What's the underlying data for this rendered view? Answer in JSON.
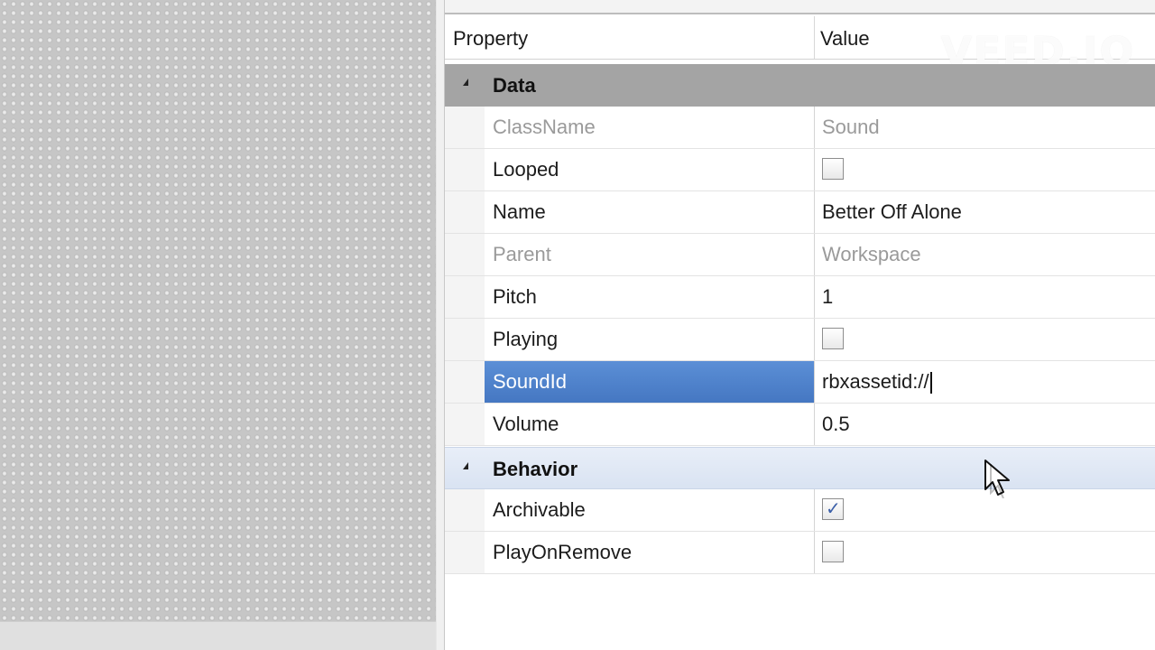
{
  "header": {
    "property_label": "Property",
    "value_label": "Value"
  },
  "watermark": "VEED.IO",
  "categories": {
    "data": {
      "label": "Data",
      "rows": [
        {
          "name": "ClassName",
          "value": "Sound",
          "readonly": true
        },
        {
          "name": "Looped",
          "type": "checkbox",
          "checked": false
        },
        {
          "name": "Name",
          "value": "Better Off Alone"
        },
        {
          "name": "Parent",
          "value": "Workspace",
          "readonly": true
        },
        {
          "name": "Pitch",
          "value": "1"
        },
        {
          "name": "Playing",
          "type": "checkbox",
          "checked": false
        },
        {
          "name": "SoundId",
          "value": "rbxassetid://",
          "selected": true,
          "editing": true
        },
        {
          "name": "Volume",
          "value": "0.5"
        }
      ]
    },
    "behavior": {
      "label": "Behavior",
      "rows": [
        {
          "name": "Archivable",
          "type": "checkbox",
          "checked": true
        },
        {
          "name": "PlayOnRemove",
          "type": "checkbox",
          "checked": false
        }
      ]
    }
  },
  "colors": {
    "selection": "#4a7dc6",
    "data_category_bg": "#a4a4a4",
    "behavior_category_bg": "#dde6f4",
    "readonly_text": "#9a9a9a",
    "checkmark": "#3b5fa8"
  }
}
